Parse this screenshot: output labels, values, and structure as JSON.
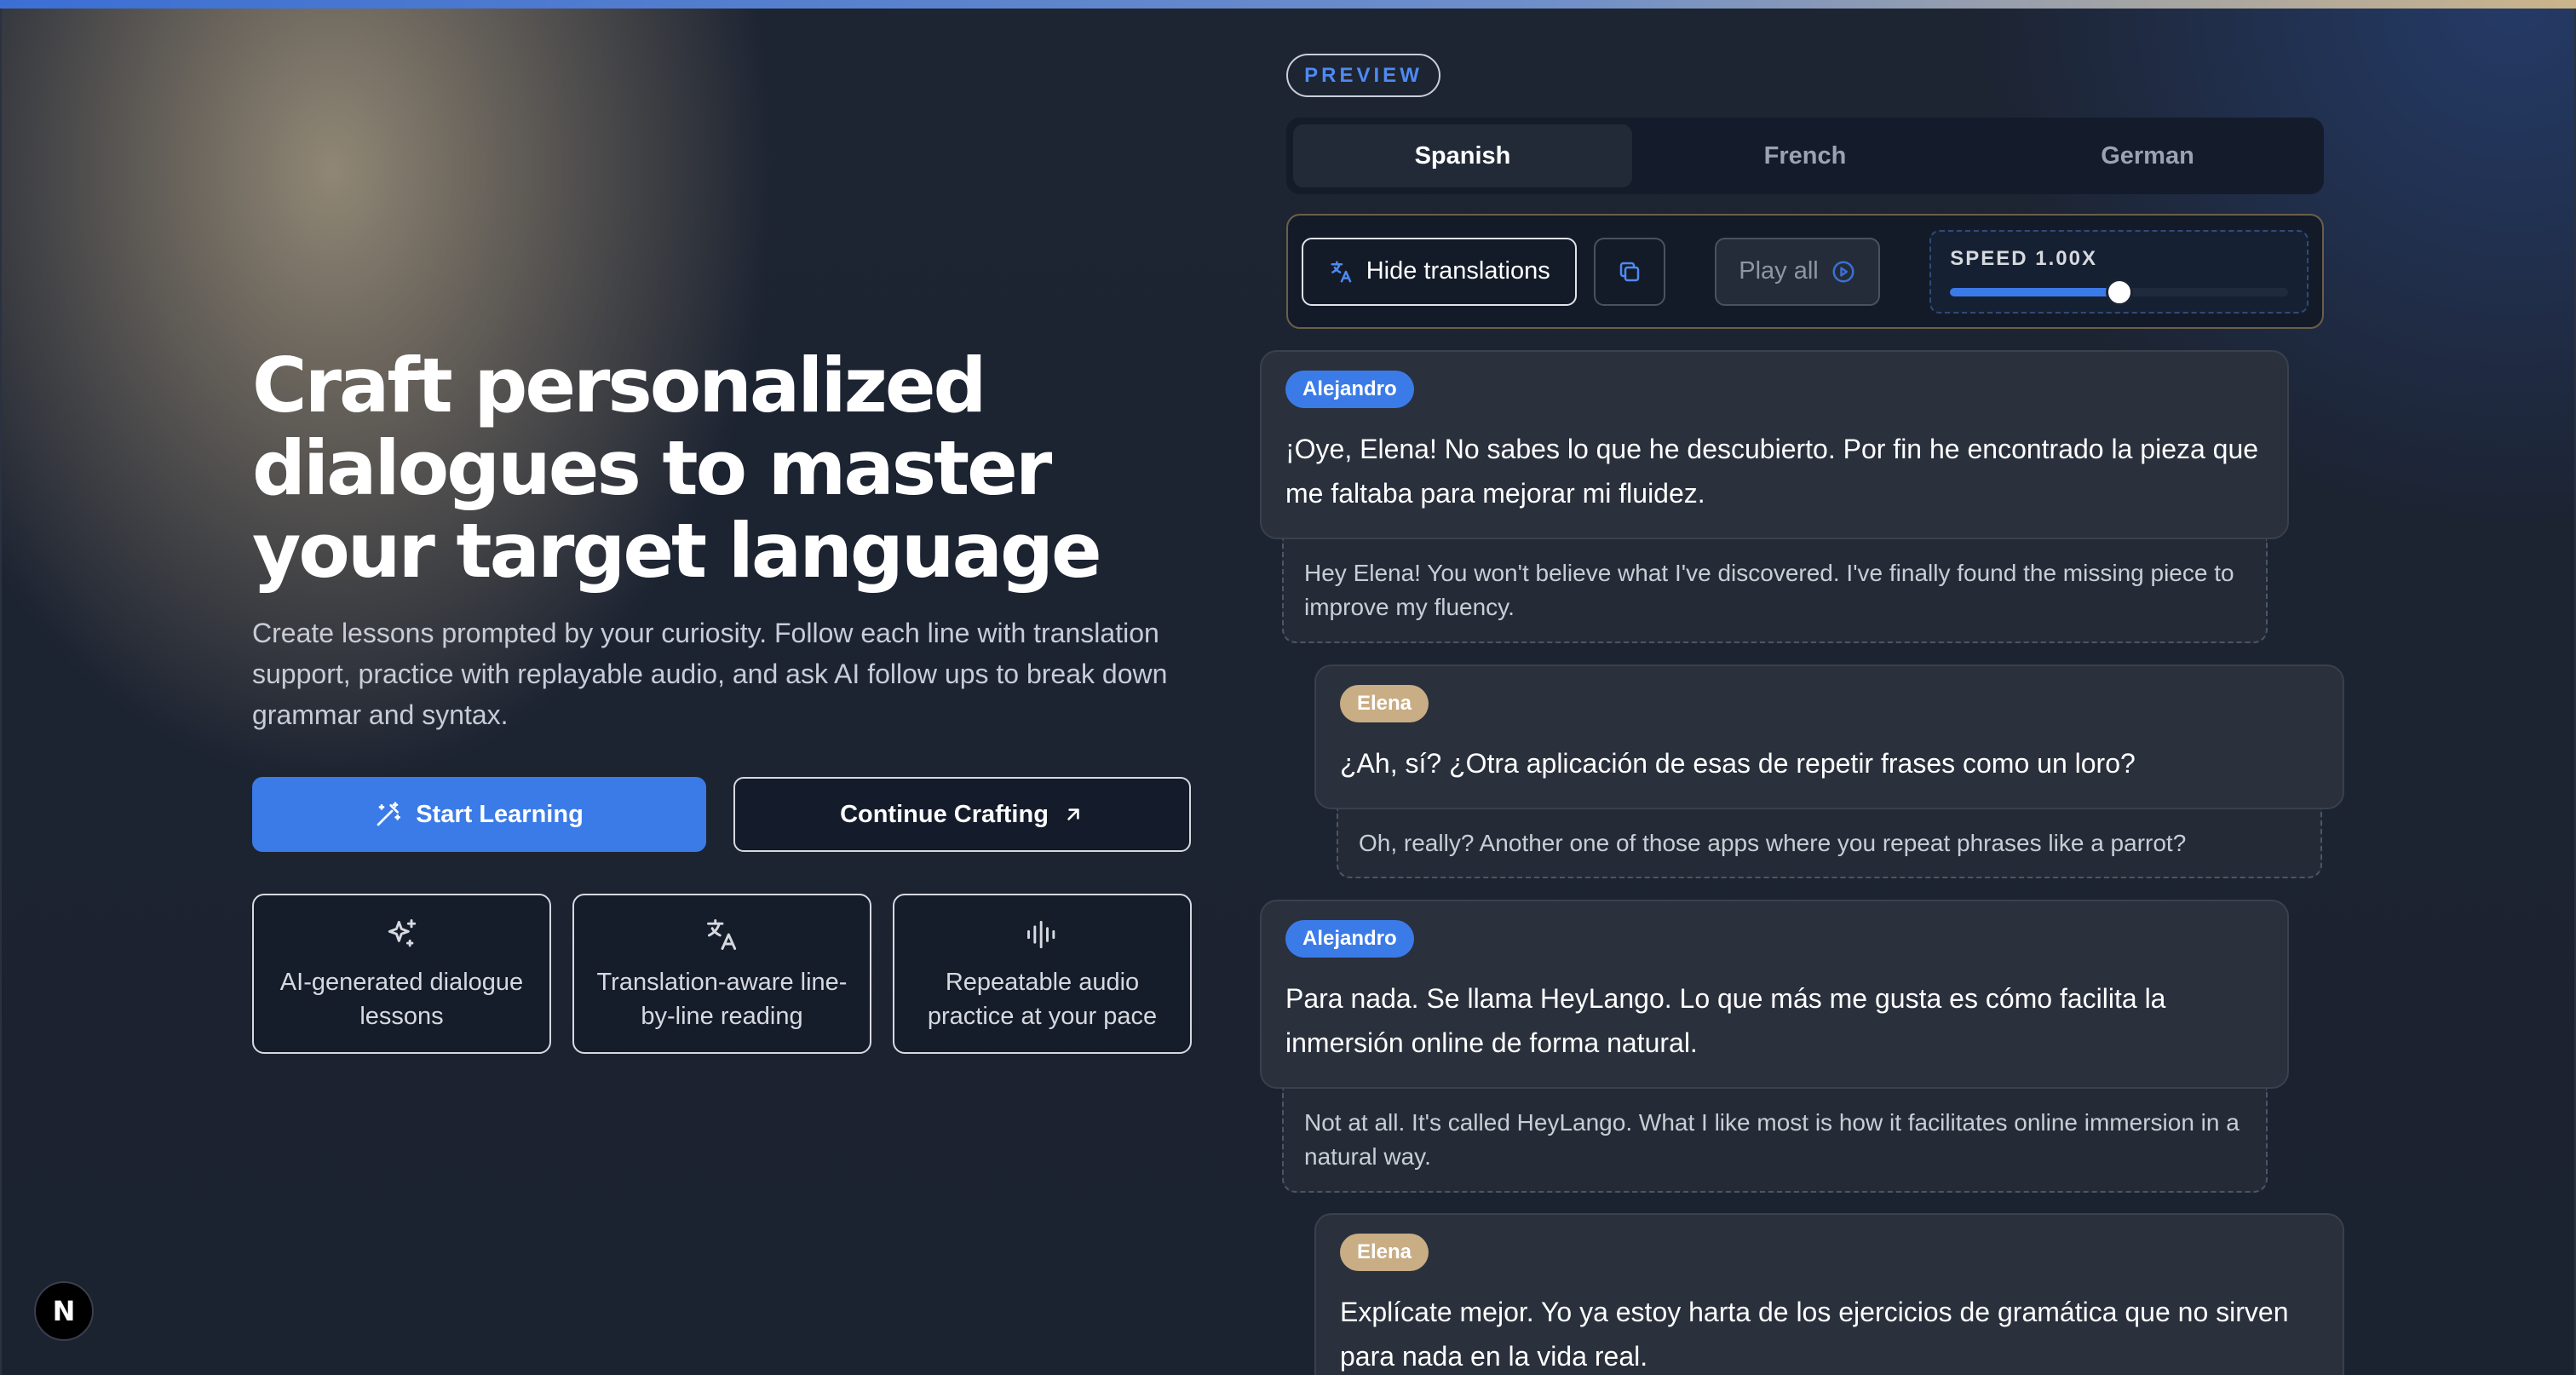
{
  "hero": {
    "title": "Craft personalized dialogues to master your target language",
    "description": "Create lessons prompted by your curiosity. Follow each line with translation support, practice with replayable audio, and ask AI follow ups to break down grammar and syntax.",
    "primary_button": "Start Learning",
    "secondary_button": "Continue Crafting",
    "features": [
      {
        "label": "AI-generated dialogue lessons",
        "icon": "sparkles-icon"
      },
      {
        "label": "Translation-aware line-by-line reading",
        "icon": "translate-icon"
      },
      {
        "label": "Repeatable audio practice at your pace",
        "icon": "audio-waveform-icon"
      }
    ]
  },
  "preview": {
    "badge": "PREVIEW",
    "languages": [
      "Spanish",
      "French",
      "German"
    ],
    "active_language": "Spanish",
    "toolbar": {
      "hide_translations": "Hide translations",
      "play_all": "Play all",
      "speed_label": "SPEED 1.00X",
      "speed_level": 0.5
    },
    "dialogue": [
      {
        "speaker": "Alejandro",
        "text": "¡Oye, Elena! No sabes lo que he descubierto. Por fin he encontrado la pieza que me faltaba para mejorar mi fluidez.",
        "translation": "Hey Elena! You won't believe what I've discovered. I've finally found the missing piece to improve my fluency."
      },
      {
        "speaker": "Elena",
        "text": "¿Ah, sí? ¿Otra aplicación de esas de repetir frases como un loro?",
        "translation": "Oh, really? Another one of those apps where you repeat phrases like a parrot?"
      },
      {
        "speaker": "Alejandro",
        "text": "Para nada. Se llama HeyLango. Lo que más me gusta es cómo facilita la inmersión online de forma natural.",
        "translation": "Not at all. It's called HeyLango. What I like most is how it facilitates online immersion in a natural way."
      },
      {
        "speaker": "Elena",
        "text": "Explícate mejor. Yo ya estoy harta de los ejercicios de gramática que no sirven para nada en la vida real.",
        "translation": ""
      }
    ]
  },
  "colors": {
    "accent": "#3b7be8",
    "speaker_a": "#3b7be8",
    "speaker_b": "#c8ad85"
  },
  "dev_badge": "N"
}
